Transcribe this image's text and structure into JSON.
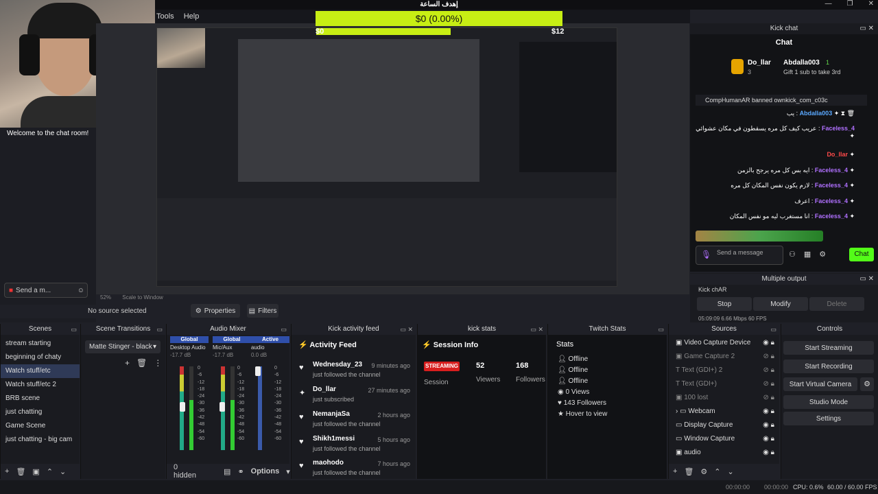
{
  "window": {
    "title": "إهدف الساعة"
  },
  "menu": [
    "Tools",
    "Help"
  ],
  "goal": {
    "text": "$0 (0.00%)",
    "left_value": "$0",
    "right_value": "$12"
  },
  "left_chat": {
    "welcome": "Welcome to the chat room!",
    "send_placeholder": "Send a m...",
    "count": "0",
    "infinity": "∞"
  },
  "preview": {
    "zoom": "52%",
    "scale_label": "Scale to Window",
    "no_source": "No source selected",
    "properties": "Properties",
    "filters": "Filters"
  },
  "scenes": {
    "title": "Scenes",
    "items": [
      "stream starting",
      "beginning of chaty",
      "Watch stuff/etc",
      "Watch stuff/etc 2",
      "BRB scene",
      "just chatting",
      "Game Scene",
      "just chatting - big cam"
    ],
    "selected": 2
  },
  "transitions": {
    "title": "Scene Transitions",
    "selected": "Matte Stinger - black"
  },
  "mixer": {
    "title": "Audio Mixer",
    "channels": [
      {
        "head": "Global",
        "name": "Desktop Audio",
        "db": "-17.7 dB"
      },
      {
        "head": "Global",
        "name": "Mic/Aux",
        "db": "-17.7 dB"
      },
      {
        "head": "Active",
        "name": "audio",
        "db": "0.0 dB"
      }
    ],
    "scale": [
      "0",
      "-6",
      "-12",
      "-18",
      "-24",
      "-30",
      "-36",
      "-42",
      "-48",
      "-54",
      "-60"
    ],
    "hidden": "0 hidden",
    "options": "Options"
  },
  "activity": {
    "title": "Kick activity feed",
    "heading": "Activity Feed",
    "items": [
      {
        "name": "Wednesday_23",
        "sub": "just followed the channel",
        "time": "9 minutes ago",
        "icon": "heart-icon"
      },
      {
        "name": "Do_llar",
        "sub": "just subscribed",
        "time": "27 minutes ago",
        "icon": "star-icon"
      },
      {
        "name": "NemanjaSa",
        "sub": "just followed the channel",
        "time": "2 hours ago",
        "icon": "heart-icon"
      },
      {
        "name": "Shikh1messi",
        "sub": "just followed the channel",
        "time": "5 hours ago",
        "icon": "heart-icon"
      },
      {
        "name": "maohodo",
        "sub": "just followed the channel",
        "time": "7 hours ago",
        "icon": "heart-icon"
      }
    ]
  },
  "kickstats": {
    "title": "kick stats",
    "heading": "Session Info",
    "badge": "STREAMING",
    "session": "Session",
    "viewers_num": "52",
    "viewers": "Viewers",
    "followers_num": "168",
    "followers": "Followers"
  },
  "twitch": {
    "title": "Twitch Stats",
    "heading": "Stats",
    "items": [
      "Offline",
      "Offline",
      "Offline",
      "0 Views",
      "143 Followers",
      "Hover to view"
    ]
  },
  "sources": {
    "title": "Sources",
    "items": [
      "Video Capture Device",
      "Game Capture 2",
      "Text (GDI+) 2",
      "Text (GDI+)",
      "100 lost",
      "Webcam",
      "Display Capture",
      "Window Capture",
      "audio"
    ]
  },
  "controls": {
    "title": "Controls",
    "buttons": [
      "Start Streaming",
      "Start Recording",
      "Start Virtual Camera",
      "Studio Mode",
      "Settings"
    ]
  },
  "kick_chat": {
    "title": "Kick chat",
    "heading": "Chat",
    "pinned_users": [
      "Do_llar",
      "Abdalla003"
    ],
    "pinned_count1": "3",
    "pinned_count2": "1",
    "gift_text": "Gift 1 sub to take 3rd",
    "ban_text": "CompHumanAR banned ownkick_com_c03c",
    "messages": [
      {
        "name": "Abdalla003",
        "text": "يب"
      },
      {
        "name": "Faceless_4",
        "text": "عريب كيف كل مره يسقطون في مكان عشوائي"
      },
      {
        "name": "Do_llar",
        "text": ""
      },
      {
        "name": "Faceless_4",
        "text": "ايه بس كل مره يرجح بالزمن"
      },
      {
        "name": "Faceless_4",
        "text": "لازم يكون نفس المكان كل مره"
      },
      {
        "name": "Faceless_4",
        "text": "اعرف"
      },
      {
        "name": "Faceless_4",
        "text": "انا مستغرب ليه مو نفس المكان"
      }
    ],
    "send_placeholder": "Send a message",
    "chat_button": "Chat"
  },
  "multiple_output": {
    "title": "Multiple output",
    "target": "Kick chAR",
    "stop": "Stop",
    "modify": "Modify",
    "delete": "Delete",
    "stats": "05:09:09  6.66 Mbps  60 FPS"
  },
  "statusbar": {
    "t1": "00:00:00",
    "t2": "00:00:00",
    "cpu": "CPU: 0.6%",
    "fps": "60.00 / 60.00 FPS"
  }
}
